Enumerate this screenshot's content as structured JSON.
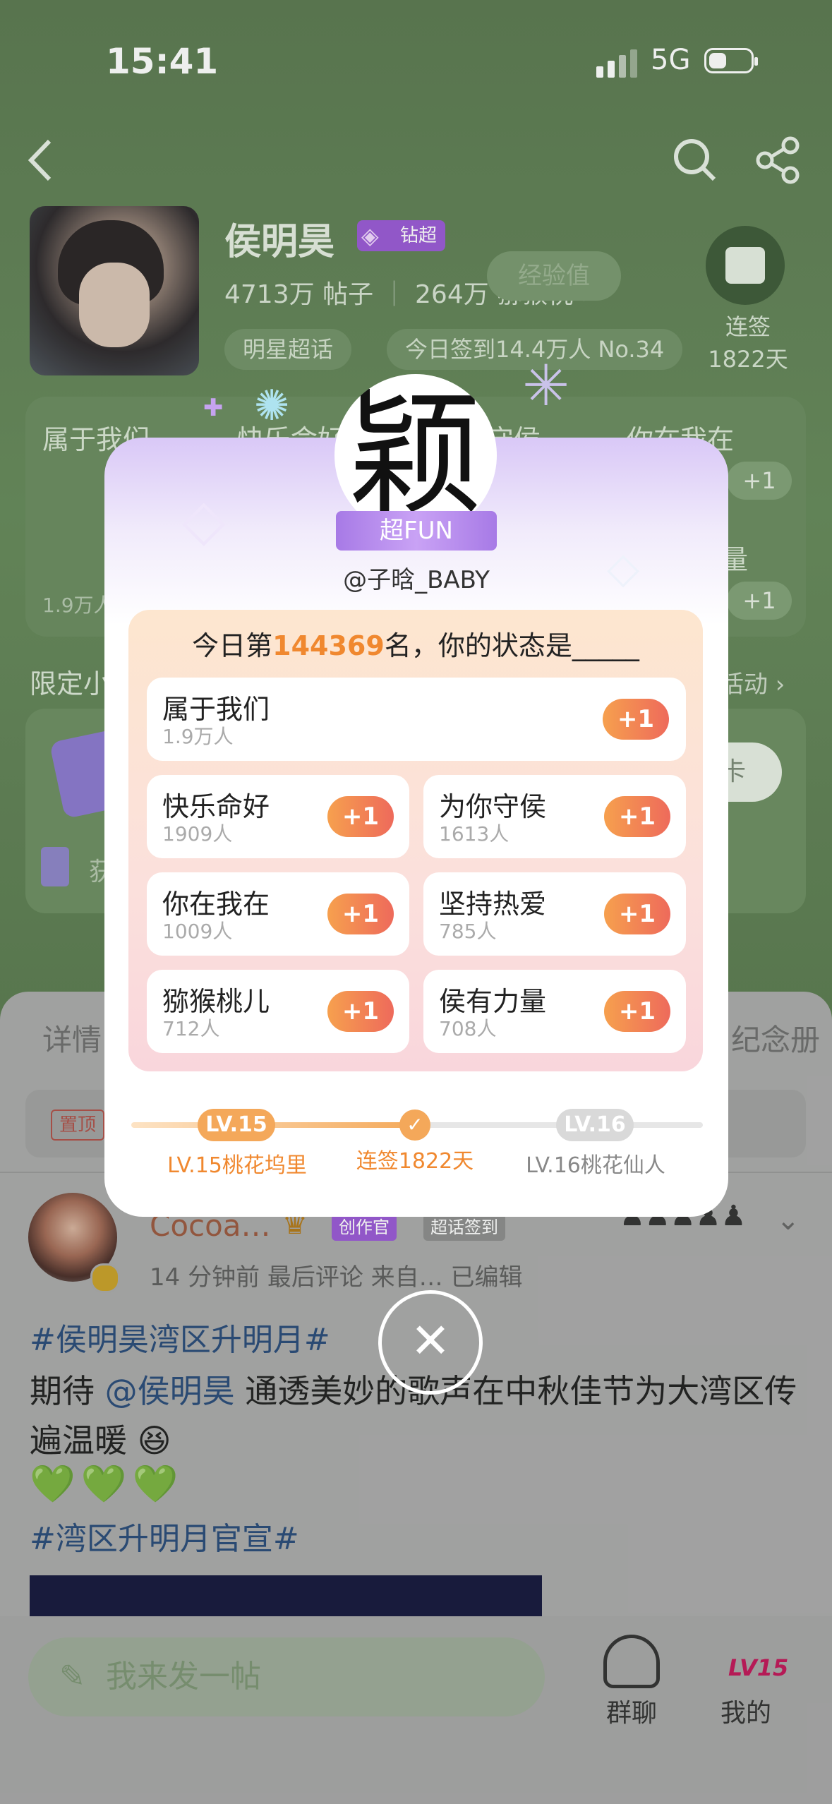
{
  "status_bar": {
    "time": "15:41",
    "network": "5G"
  },
  "header": {
    "back_icon": "chevron-left-icon",
    "search_icon": "search-icon",
    "share_icon": "share-icon"
  },
  "profile": {
    "name": "侯明昊",
    "badge": "钻超",
    "posts_count": "4713万",
    "posts_label": "帖子",
    "fans_count": "264万",
    "fans_label": "猕猴桃",
    "exp_label": "经验值",
    "tag_super": "明星超话",
    "tag_checkin": "今日签到14.4万人 No.34",
    "streak_title": "连签",
    "streak_days": "1822天"
  },
  "groups_bg": {
    "title1": "属于我们",
    "title2": "快乐命好",
    "title3": "守侯",
    "title4": "你在我在",
    "count1": "1.9万人",
    "right_label": "量",
    "plus": "+1"
  },
  "limited": {
    "title": "限定小",
    "activity": "活动",
    "checkin_btn": "卡",
    "bottom_text": "获"
  },
  "tabs": {
    "left": "详情",
    "right": "纪念册"
  },
  "pinned": {
    "label": "置顶"
  },
  "post": {
    "author": "Cocoa…",
    "badge_creator": "创作官",
    "badge_checkin": "超话签到",
    "meta": "14 分钟前  最后评论   来自…  已编辑",
    "hashtag1": "#侯明昊湾区升明月#",
    "text_before": "期待 ",
    "mention": "@侯明昊",
    "text_after": " 通透美妙的歌声在中秋佳节为大湾区传遍温暖",
    "hearts": "💚💚💚",
    "hashtag2": "#湾区升明月官宣#"
  },
  "bottom": {
    "compose_placeholder": "我来发一帖",
    "group_chat": "群聊",
    "mine": "我的",
    "mine_level": "LV15"
  },
  "modal": {
    "avatar_char": "颖",
    "ribbon": "超FUN",
    "handle": "@子晗_BABY",
    "title_prefix": "今日第",
    "rank": "144369",
    "title_suffix": "名，你的状态是_____",
    "options": [
      {
        "label": "属于我们",
        "count": "1.9万人",
        "button": "+1"
      },
      {
        "label": "快乐命好",
        "count": "1909人",
        "button": "+1"
      },
      {
        "label": "为你守侯",
        "count": "1613人",
        "button": "+1"
      },
      {
        "label": "你在我在",
        "count": "1009人",
        "button": "+1"
      },
      {
        "label": "坚持热爱",
        "count": "785人",
        "button": "+1"
      },
      {
        "label": "猕猴桃儿",
        "count": "712人",
        "button": "+1"
      },
      {
        "label": "侯有力量",
        "count": "708人",
        "button": "+1"
      }
    ],
    "level_current": "LV.15",
    "level_current_name": "LV.15桃花坞里",
    "streak": "连签1822天",
    "level_next": "LV.16",
    "level_next_name": "LV.16桃花仙人"
  },
  "colors": {
    "accent_orange": "#f0882f",
    "bg_green": "#5f7f54",
    "modal_purple": "#a77ae6"
  }
}
